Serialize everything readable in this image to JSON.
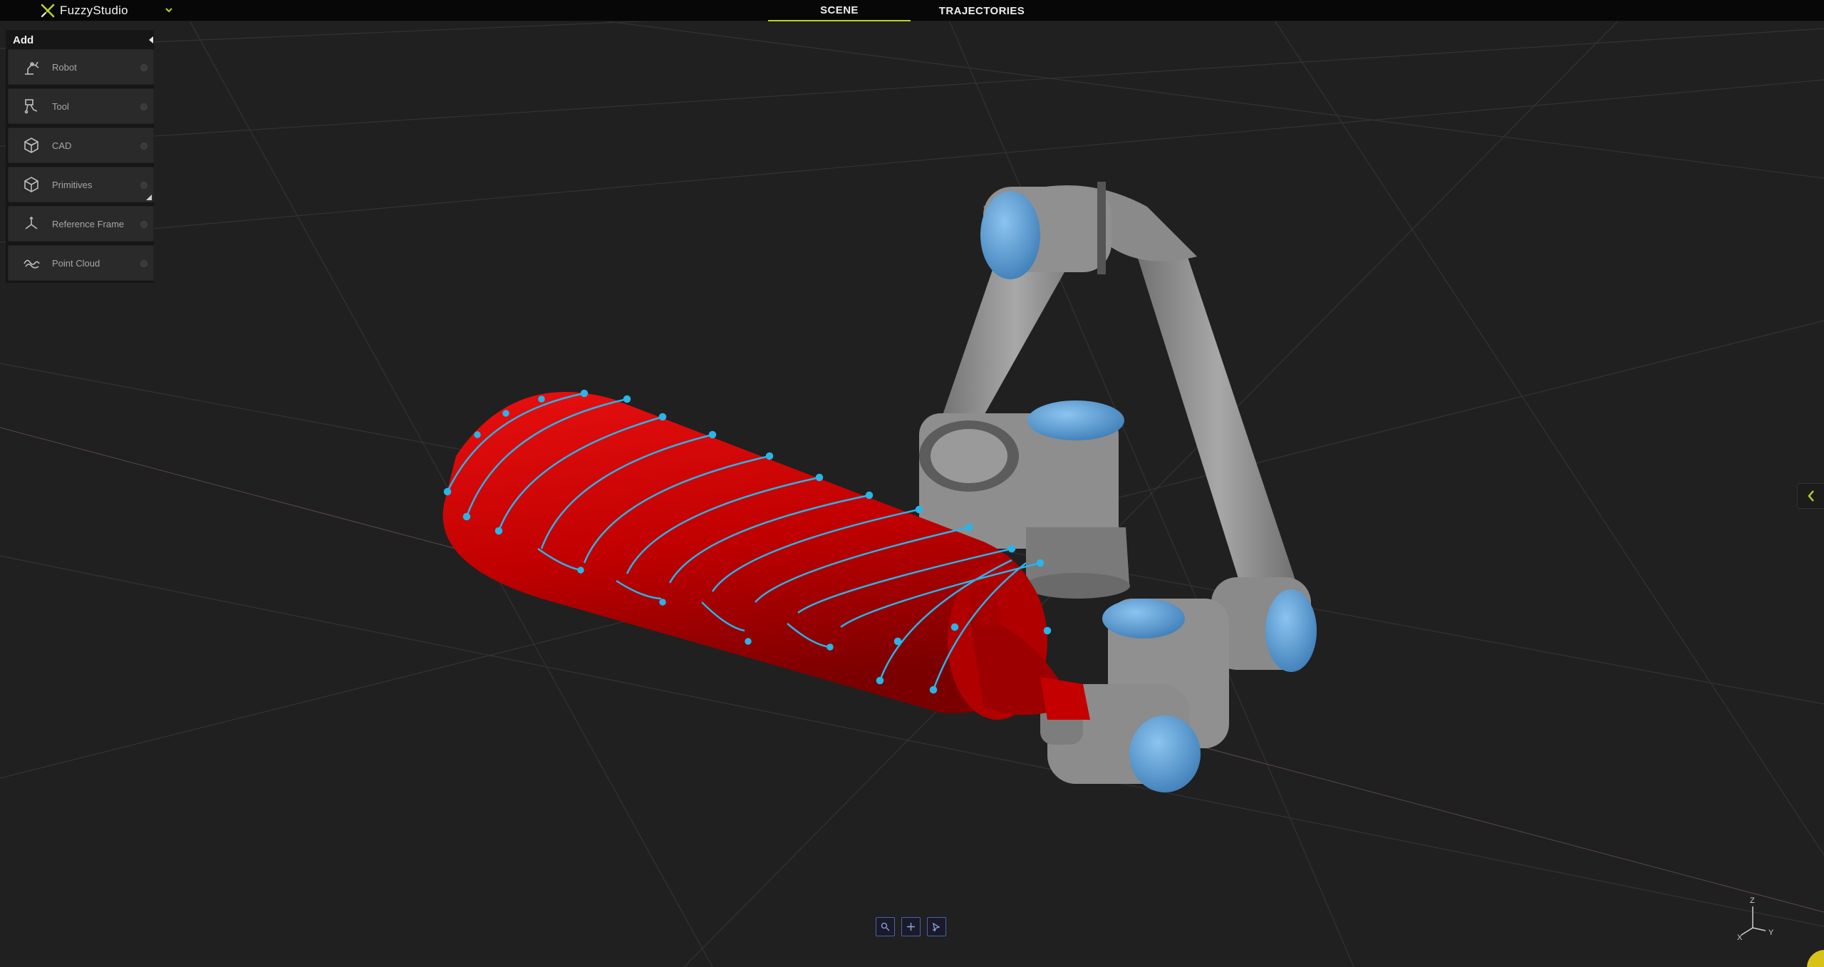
{
  "app": {
    "brand_name": "FuzzyStudio",
    "accent_color": "#b9d32c"
  },
  "tabs": [
    {
      "label": "SCENE",
      "active": true
    },
    {
      "label": "TRAJECTORIES",
      "active": false
    }
  ],
  "add_panel": {
    "title": "Add",
    "items": [
      {
        "label": "Robot",
        "icon": "robot-arm-icon"
      },
      {
        "label": "Tool",
        "icon": "tool-icon"
      },
      {
        "label": "CAD",
        "icon": "cad-cube-icon"
      },
      {
        "label": "Primitives",
        "icon": "primitive-cube-icon"
      },
      {
        "label": "Reference Frame",
        "icon": "reference-frame-icon"
      },
      {
        "label": "Point Cloud",
        "icon": "point-cloud-icon"
      }
    ]
  },
  "scene": {
    "ground_color": "#202020",
    "grid_color": "#3a3a3a",
    "object_color": "#cc0000",
    "trajectory_color": "#2ab4e8",
    "robot_body_color": "#8a8a8a",
    "robot_cap_color": "#5d9ed6"
  },
  "bottom_toolbar": {
    "buttons": [
      "zoom-fit-icon",
      "add-point-icon",
      "select-icon"
    ]
  },
  "gizmo": {
    "z": "Z",
    "x": "X",
    "y": "Y"
  }
}
